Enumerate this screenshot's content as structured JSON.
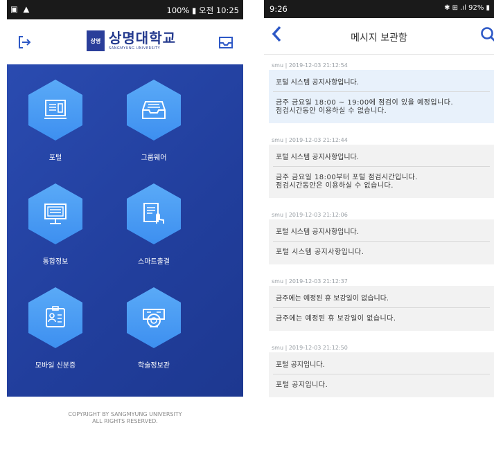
{
  "left_phone": {
    "status_bar": {
      "left_icons": "▣ ▲",
      "right_text": "100% ▮ 오전 10:25"
    },
    "header": {
      "logo_text_ko": "상명대학교",
      "logo_text_en": "SANGMYUNG UNIVERSITY",
      "logo_mark": "상명"
    },
    "menu": [
      {
        "label": "포털",
        "icon": "portal-icon"
      },
      {
        "label": "그룹웨어",
        "icon": "inbox-icon"
      },
      {
        "label": "통합정보",
        "icon": "monitor-icon"
      },
      {
        "label": "스마트출결",
        "icon": "touch-document-icon"
      },
      {
        "label": "모바일 신분증",
        "icon": "id-card-icon"
      },
      {
        "label": "학술정보관",
        "icon": "library-icon"
      }
    ],
    "copyright_line1": "COPYRIGHT BY SANGMYUNG UNIVERSITY",
    "copyright_line2": "ALL RIGHTS RESERVED."
  },
  "right_phone": {
    "status_bar": {
      "time": "9:26",
      "right_text": "✱ ⊞ .ıl 92% ▮"
    },
    "nav": {
      "title": "메시지 보관함"
    },
    "messages": [
      {
        "meta": "smu | 2019-12-03 21:12:54",
        "title": "포털 시스템 공지사항입니다.",
        "body": "금주 금요일 18:00 ~ 19:00에 점검이 있을 예정입니다.\n점검시간동안 이용하실 수 없습니다.",
        "highlighted": true
      },
      {
        "meta": "smu | 2019-12-03 21:12:44",
        "title": "포털 시스템 공지사항입니다.",
        "body": "금주 금요일 18:00부터 포털 점검시간입니다.\n점검시간동안은 이용하실 수 없습니다.",
        "highlighted": false
      },
      {
        "meta": "smu | 2019-12-03 21:12:06",
        "title": "포털 시스템 공지사항입니다.",
        "body": "포털 시스템 공지사항입니다.",
        "highlighted": false
      },
      {
        "meta": "smu | 2019-12-03 21:12:37",
        "title": "금주에는 예정된 휴 보강일이 없습니다.",
        "body": "금주에는 예정된 휴 보강일이 없습니다.",
        "highlighted": false
      },
      {
        "meta": "smu | 2019-12-03 21:12:50",
        "title": "포털 공지입니다.",
        "body": "포털 공지입니다.",
        "highlighted": false
      }
    ]
  },
  "colors": {
    "brand_blue": "#2a4bb0",
    "accent": "#2d58c6",
    "hex_tile": "#4a9cf4"
  }
}
